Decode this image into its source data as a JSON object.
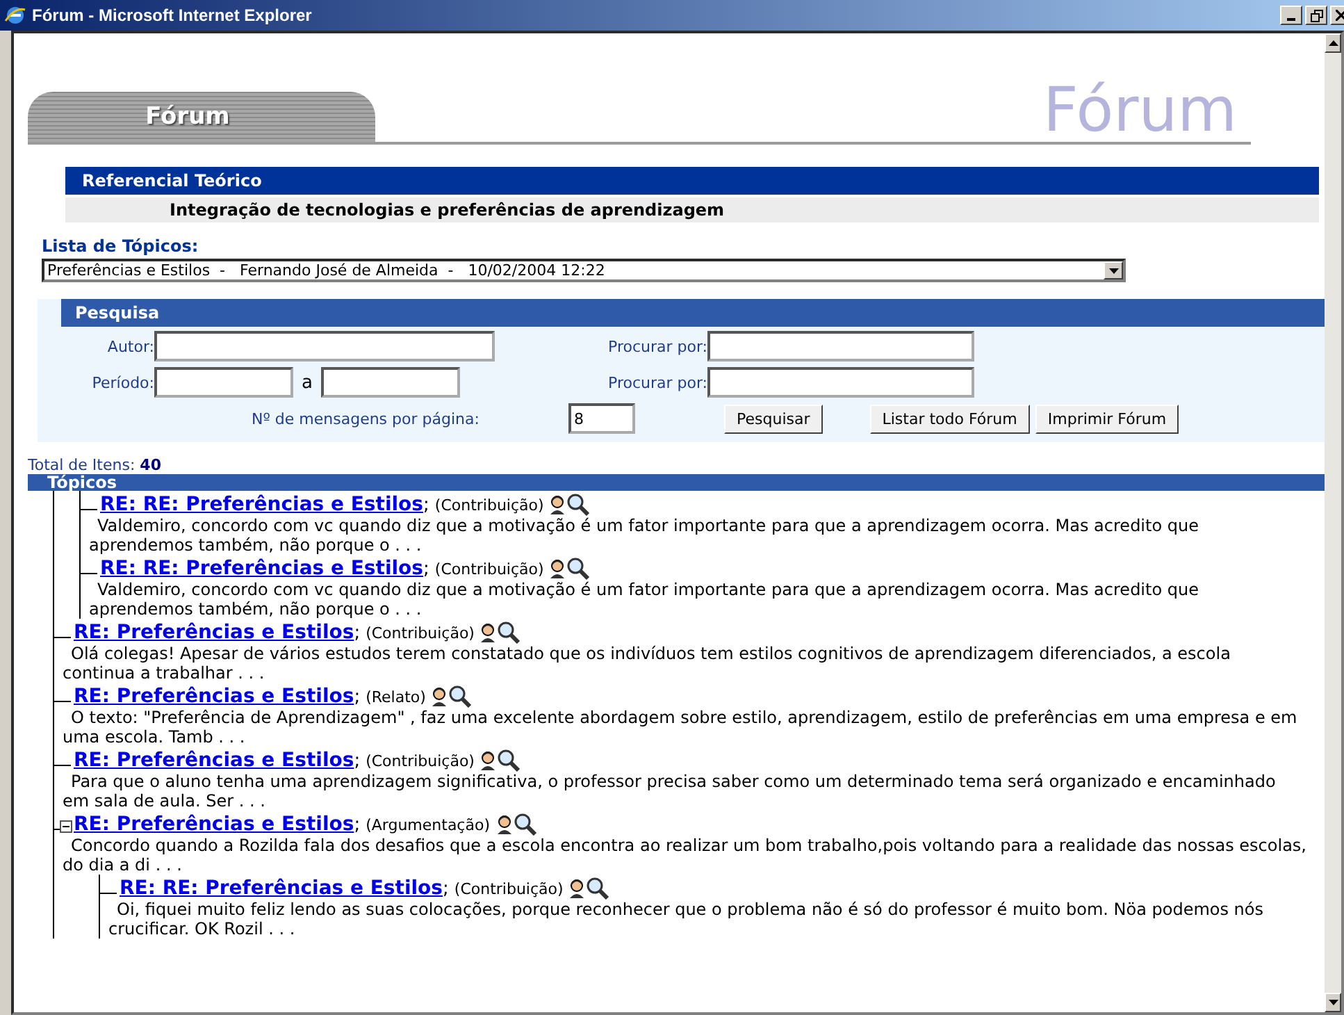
{
  "window": {
    "title": "Fórum - Microsoft Internet Explorer"
  },
  "header": {
    "tab": "Fórum",
    "watermark": "Fórum"
  },
  "section": {
    "title": "Referencial Teórico",
    "subtitle": "Integração de tecnologias e preferências de aprendizagem"
  },
  "topic_list": {
    "label": "Lista de Tópicos:",
    "value": "Preferências e Estilos  -   Fernando José de Almeida  -   10/02/2004 12:22"
  },
  "search": {
    "title": "Pesquisa",
    "author_label": "Autor:",
    "search_label_1": "Procurar por:",
    "period_label": "Período:",
    "period_sep": "a",
    "search_label_2": "Procurar por:",
    "per_page_label": "Nº de mensagens por página:",
    "per_page_value": "8",
    "buttons": [
      "Pesquisar",
      "Listar todo Fórum",
      "Imprimir Fórum"
    ]
  },
  "total": {
    "label": "Total de Itens:",
    "value": "40"
  },
  "topics_header": "Tópicos",
  "topics": [
    {
      "children": [
        {
          "title": "RE: RE: Preferências e Estilos",
          "separator": ";",
          "type": "(Contribuição)",
          "excerpt": "Valdemiro, concordo com vc quando diz que a motivação é um fator importante para que a aprendizagem ocorra. Mas acredito que aprendemos também, não porque o . . ."
        },
        {
          "title": "RE: RE: Preferências e Estilos",
          "separator": ";",
          "type": "(Contribuição)",
          "excerpt": "Valdemiro, concordo com vc quando diz que a motivação é um fator importante para que a aprendizagem ocorra. Mas acredito que aprendemos também, não porque o . . ."
        }
      ]
    },
    {
      "title": "RE: Preferências e Estilos",
      "separator": ";",
      "type": "(Contribuição)",
      "excerpt": "Olá colegas! Apesar de vários estudos terem constatado que os indivíduos tem estilos cognitivos de aprendizagem diferenciados, a escola continua a trabalhar . . ."
    },
    {
      "title": "RE: Preferências e Estilos",
      "separator": ";",
      "type": "(Relato)",
      "excerpt": "O texto: \"Preferência de Aprendizagem\" , faz uma excelente abordagem sobre estilo, aprendizagem, estilo de preferências em uma empresa e em uma escola. Tamb . . ."
    },
    {
      "title": "RE: Preferências e Estilos",
      "separator": ";",
      "type": "(Contribuição)",
      "excerpt": "Para que o aluno tenha uma aprendizagem significativa, o professor precisa saber como um determinado tema será organizado e encaminhado em sala de aula. Ser . . ."
    },
    {
      "title": "RE: Preferências e Estilos",
      "separator": ";",
      "type": "(Argumentação)",
      "excerpt": "Concordo quando a Rozilda fala dos desafios que a escola encontra ao realizar um bom trabalho,pois voltando para a realidade das nossas escolas, do dia a di . . .",
      "expanded": true,
      "children": [
        {
          "title": "RE: RE: Preferências e Estilos",
          "separator": ";",
          "type": "(Contribuição)",
          "excerpt": "Oi, fiquei muito feliz lendo as suas colocações, porque reconhecer que o problema não é só do professor é muito bom. Nöa podemos nós crucificar. OK Rozil . . ."
        }
      ]
    }
  ]
}
